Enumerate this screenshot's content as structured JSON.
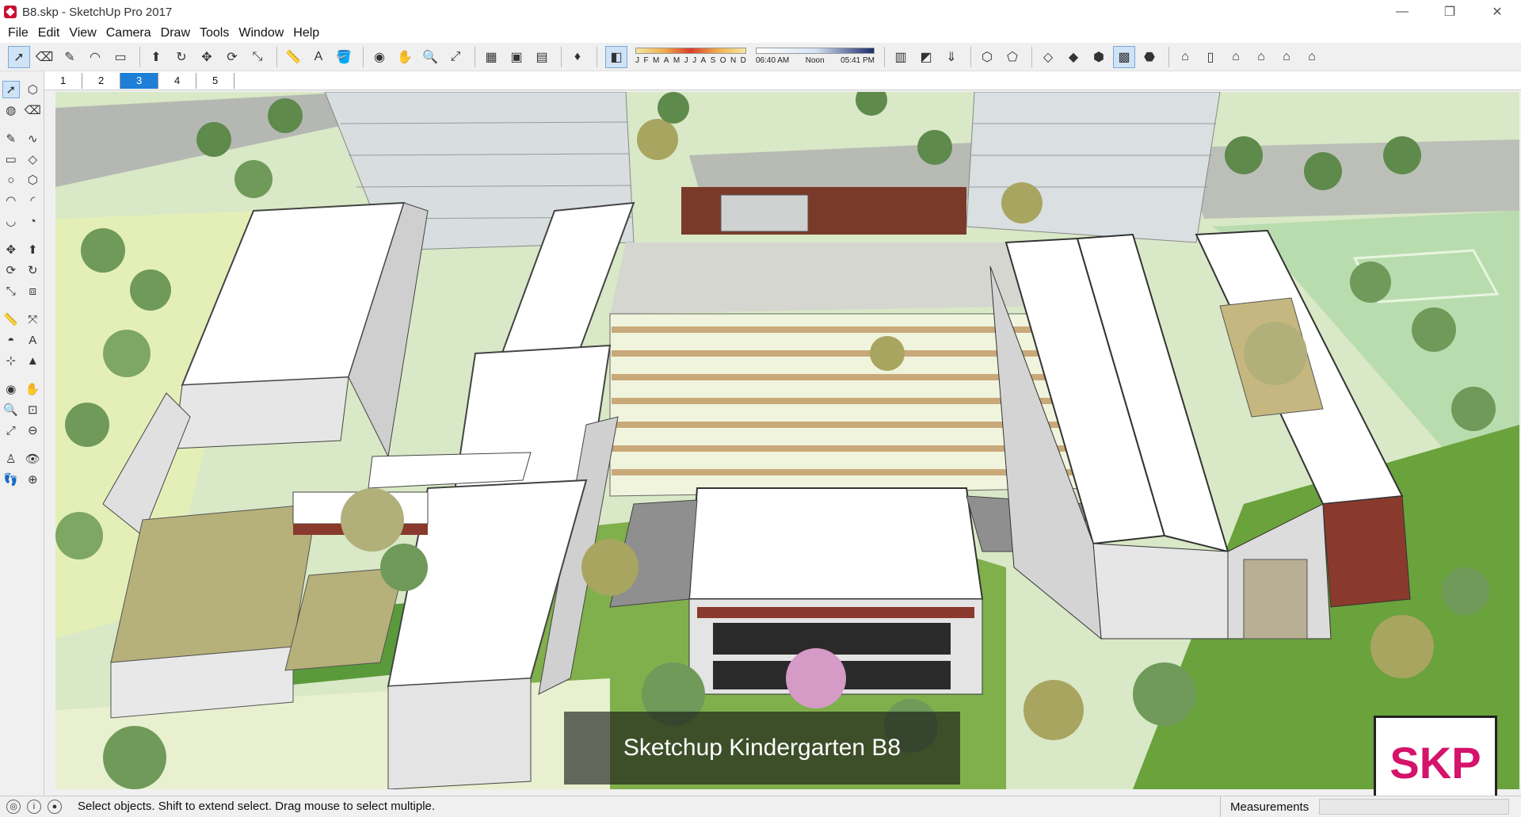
{
  "window": {
    "title": "B8.skp - SketchUp Pro 2017",
    "minimize": "—",
    "restore": "❐",
    "close": "✕"
  },
  "menu": [
    "File",
    "Edit",
    "View",
    "Camera",
    "Draw",
    "Tools",
    "Window",
    "Help"
  ],
  "shadows": {
    "months": [
      "J",
      "F",
      "M",
      "A",
      "M",
      "J",
      "J",
      "A",
      "S",
      "O",
      "N",
      "D"
    ],
    "time_start": "06:40 AM",
    "time_mid": "Noon",
    "time_end": "05:41 PM"
  },
  "scenes": {
    "tabs": [
      "1",
      "2",
      "3",
      "4",
      "5"
    ],
    "active": "3"
  },
  "viewport": {
    "caption": "Sketchup Kindergarten B8",
    "logo": "SKP"
  },
  "status": {
    "hint": "Select objects. Shift to extend select. Drag mouse to select multiple.",
    "measurements_label": "Measurements",
    "measurements_value": ""
  },
  "colors": {
    "scene_active": "#1e7fd6",
    "logo_pink": "#d4136b",
    "roof_white": "#ffffff",
    "brick": "#8a3a2c",
    "lawn": "#5a9a3a"
  }
}
